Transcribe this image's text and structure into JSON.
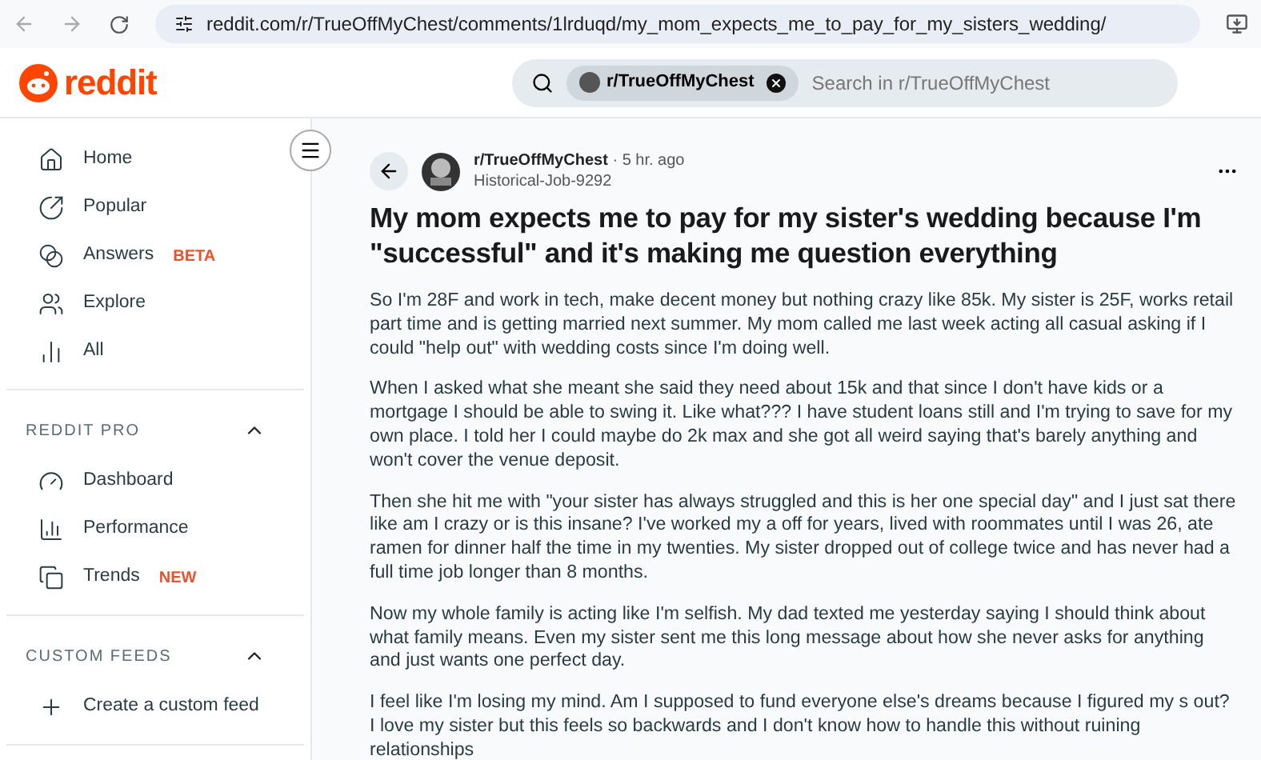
{
  "browser": {
    "url": "reddit.com/r/TrueOffMyChest/comments/1lrduqd/my_mom_expects_me_to_pay_for_my_sisters_wedding/"
  },
  "header": {
    "logo": "reddit",
    "search": {
      "chip": "r/TrueOffMyChest",
      "placeholder": "Search in r/TrueOffMyChest"
    }
  },
  "sidebar": {
    "items": [
      {
        "kind": "home",
        "label": "Home"
      },
      {
        "kind": "popular",
        "label": "Popular"
      },
      {
        "kind": "answers",
        "label": "Answers",
        "badge": "BETA"
      },
      {
        "kind": "explore",
        "label": "Explore"
      },
      {
        "kind": "all",
        "label": "All"
      }
    ],
    "sections": [
      {
        "title": "REDDIT PRO",
        "expanded": true,
        "items": [
          {
            "kind": "dashboard",
            "label": "Dashboard"
          },
          {
            "kind": "performance",
            "label": "Performance"
          },
          {
            "kind": "trends",
            "label": "Trends",
            "badge": "NEW"
          }
        ]
      },
      {
        "title": "CUSTOM FEEDS",
        "expanded": true,
        "items": [
          {
            "kind": "create",
            "label": "Create a custom feed"
          }
        ]
      }
    ]
  },
  "post": {
    "subreddit": "r/TrueOffMyChest",
    "separator": "·",
    "time": "5 hr. ago",
    "author": "Historical-Job-9292",
    "title": "My mom expects me to pay for my sister's wedding because I'm \"successful\" and it's making me question everything",
    "paragraphs": [
      "So I'm 28F and work in tech, make decent money but nothing crazy like 85k. My sister is 25F, works retail part time and is getting married next summer. My mom called me last week acting all casual asking if I could \"help out\" with wedding costs since I'm doing well.",
      "When I asked what she meant she said they need about 15k and that since I don't have kids or a mortgage I should be able to swing it. Like what??? I have student loans still and I'm trying to save for my own place. I told her I could maybe do 2k max and she got all weird saying that's barely anything and won't cover the venue deposit.",
      "Then she hit me with \"your sister has always struggled and this is her one special day\" and I just sat there like am I crazy or is this insane? I've worked my a off for years, lived with roommates until I was 26, ate ramen for dinner half the time in my twenties. My sister dropped out of college twice and has never had a full time job longer than 8 months.",
      "Now my whole family is acting like I'm selfish. My dad texted me yesterday saying I should think about what family means. Even my sister sent me this long message about how she never asks for anything and just wants one perfect day.",
      "I feel like I'm losing my mind. Am I supposed to fund everyone else's dreams because I figured my s out? I love my sister but this feels so backwards and I don't know how to handle this without ruining relationships"
    ]
  }
}
